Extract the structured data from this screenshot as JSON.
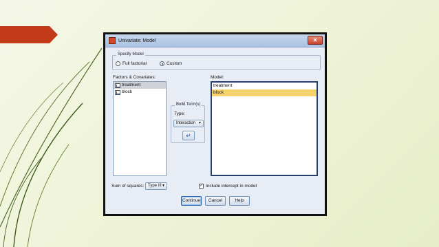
{
  "colors": {
    "accent": "#c23a18",
    "model_selected": "#f6d36a",
    "list_selected": "#cfd3d9"
  },
  "dialog": {
    "title": "Univariate: Model",
    "close_symbol": "✕",
    "specify_model": {
      "label": "Specify Model",
      "options": [
        "Full factorial",
        "Custom"
      ],
      "selected": "Custom"
    },
    "factors": {
      "label": "Factors & Covariates:",
      "items": [
        "treatment",
        "block"
      ]
    },
    "build_terms": {
      "label": "Build Term(s)",
      "type_label": "Type:",
      "type_value": "Interaction",
      "arrow_icon": "move-right-arrow"
    },
    "model": {
      "label": "Model:",
      "items": [
        "treatment",
        "block"
      ]
    },
    "sum_of_squares": {
      "label": "Sum of squares:",
      "value": "Type III"
    },
    "include_intercept": {
      "label": "Include intercept in model",
      "checked": true
    },
    "buttons": [
      "Continue",
      "Cancel",
      "Help"
    ]
  }
}
